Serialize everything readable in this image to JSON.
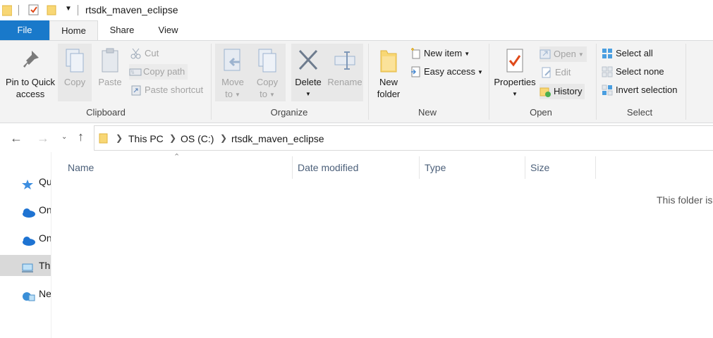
{
  "window": {
    "title": "rtsdk_maven_eclipse"
  },
  "tabs": [
    {
      "label": "File"
    },
    {
      "label": "Home"
    },
    {
      "label": "Share"
    },
    {
      "label": "View"
    }
  ],
  "ribbon": {
    "clipboard": {
      "pin_label_1": "Pin to Quick",
      "pin_label_2": "access",
      "copy": "Copy",
      "paste": "Paste",
      "cut": "Cut",
      "copy_path": "Copy path",
      "paste_shortcut": "Paste shortcut",
      "group": "Clipboard"
    },
    "organize": {
      "move_1": "Move",
      "move_2": "to",
      "copy_1": "Copy",
      "copy_2": "to",
      "delete": "Delete",
      "rename": "Rename",
      "group": "Organize"
    },
    "new": {
      "folder_1": "New",
      "folder_2": "folder",
      "new_item": "New item",
      "easy_access": "Easy access",
      "group": "New"
    },
    "open": {
      "properties": "Properties",
      "open": "Open",
      "edit": "Edit",
      "history": "History",
      "group": "Open"
    },
    "select": {
      "select_all": "Select all",
      "select_none": "Select none",
      "invert": "Invert selection",
      "group": "Select"
    }
  },
  "breadcrumb": [
    "This PC",
    "OS (C:)",
    "rtsdk_maven_eclipse"
  ],
  "nav": [
    {
      "label": "Qu"
    },
    {
      "label": "On"
    },
    {
      "label": "On"
    },
    {
      "label": "Th"
    },
    {
      "label": "Ne"
    }
  ],
  "columns": [
    "Name",
    "Date modified",
    "Type",
    "Size"
  ],
  "empty_message": "This folder is",
  "colors": {
    "accent": "#1979ca",
    "ribbon_bg": "#f3f3f3",
    "selected_nav": "#cce8ff"
  }
}
